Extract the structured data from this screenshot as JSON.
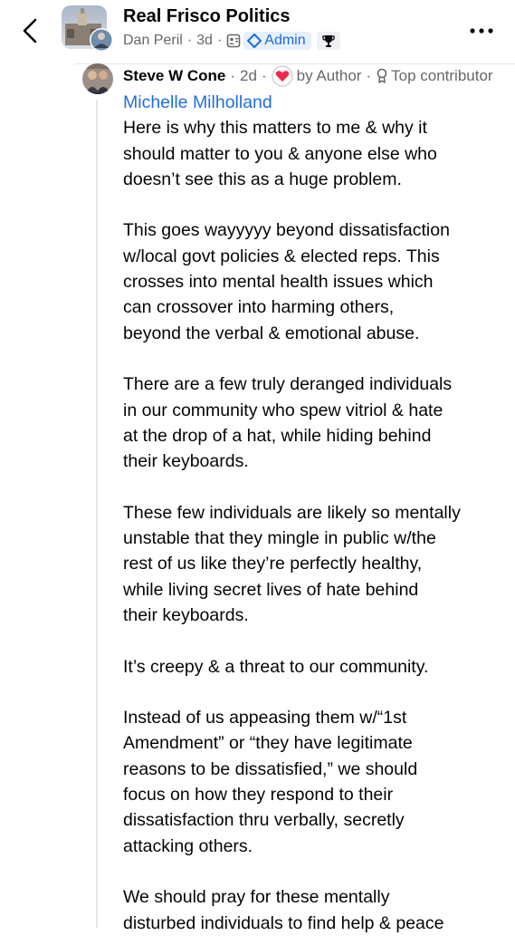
{
  "header": {
    "group_name": "Real Frisco Politics",
    "poster_name": "Dan Peril",
    "time": "3d",
    "admin_label": "Admin",
    "icons": [
      "back-arrow-icon",
      "group-icon",
      "admin-diamond-icon",
      "trophy-icon",
      "more-icon"
    ]
  },
  "comment": {
    "author": "Steve W Cone",
    "time": "2d",
    "by_author_label": "by Author",
    "top_contributor_label": "Top contributor",
    "mention": "Michelle Milholland",
    "paragraphs": [
      "Here is why this matters to me & why it\nshould matter to you & anyone else who\ndoesn’t see this as a huge problem.",
      "This goes wayyyyy beyond dissatisfaction\nw/local govt policies & elected reps. This\ncrosses into mental health issues which\ncan crossover into  harming others,\nbeyond the verbal & emotional abuse.",
      "There are a few truly deranged individuals\nin our community who spew vitriol & hate\nat the drop of a hat, while hiding behind\ntheir keyboards.",
      "These few individuals are likely so mentally\nunstable that they mingle in public w/the\nrest of us like they’re perfectly healthy,\nwhile living secret lives of hate behind\ntheir keyboards.",
      "It’s creepy & a threat to our community.",
      "Instead of us appeasing them w/“1st\nAmendment” or “they have legitimate\nreasons to be dissatisfied,” we should\nfocus on how they respond to their\ndissatisfaction thru verbally, secretly\nattacking others.",
      "We should pray for these mentally\ndisturbed individuals to find help & peace"
    ]
  },
  "colors": {
    "link_blue": "#216fdb",
    "admin_blue": "#1b6ae0",
    "muted_gray": "#65676b",
    "heart_red": "#f02849"
  }
}
